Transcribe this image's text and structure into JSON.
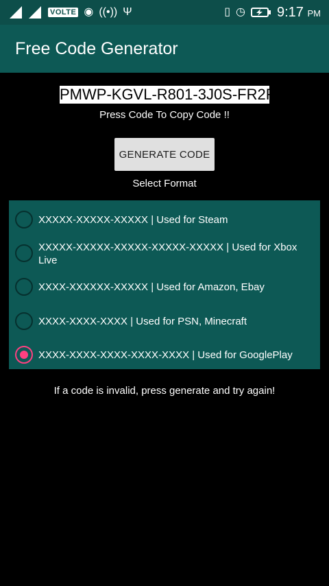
{
  "status_bar": {
    "network_badge": "VOLTE",
    "time": "9:17",
    "ampm": "PM"
  },
  "app_bar": {
    "title": "Free Code Generator"
  },
  "main": {
    "generated_code": "PMWP-KGVL-R801-3J0S-FR2R",
    "copy_hint": "Press Code To Copy Code !!",
    "generate_button_label": "GENERATE CODE",
    "select_format_label": "Select Format",
    "formats": [
      {
        "label": "XXXXX-XXXXX-XXXXX | Used for Steam",
        "checked": false
      },
      {
        "label": "XXXXX-XXXXX-XXXXX-XXXXX-XXXXX | Used for Xbox Live",
        "checked": false
      },
      {
        "label": "XXXX-XXXXXX-XXXXX | Used for Amazon, Ebay",
        "checked": false
      },
      {
        "label": "XXXX-XXXX-XXXX | Used for PSN, Minecraft",
        "checked": false
      },
      {
        "label": "XXXX-XXXX-XXXX-XXXX-XXXX | Used for GooglePlay",
        "checked": true
      }
    ],
    "footer_hint": "If a code is invalid, press generate and try again!"
  },
  "colors": {
    "status_bar": "#0d4e4a",
    "app_bar": "#0d5955",
    "accent": "#ff4081",
    "background": "#000000"
  }
}
